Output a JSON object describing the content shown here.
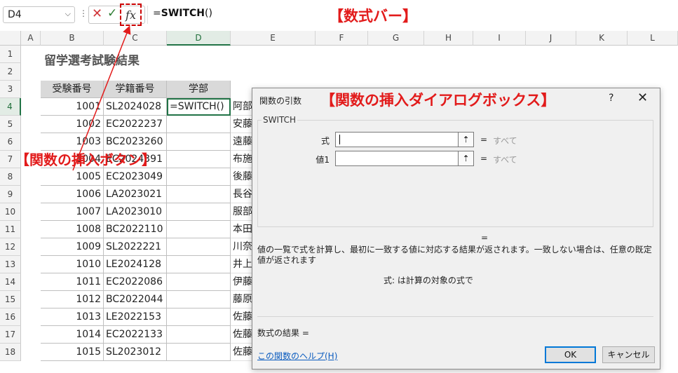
{
  "formula_bar": {
    "name_box": "D4",
    "formula_prefix": "=",
    "formula_func": "SWITCH",
    "formula_suffix": "()",
    "cancel_icon": "x-icon",
    "enter_icon": "check-icon",
    "fx_label": "fx"
  },
  "annotations": {
    "formula_bar": "【数式バー】",
    "insert_button": "【関数の挿入ボタン】",
    "dialog": "【関数の挿入ダイアログボックス】"
  },
  "columns": [
    "A",
    "B",
    "C",
    "D",
    "E",
    "F",
    "G",
    "H",
    "I",
    "J",
    "K",
    "L"
  ],
  "rows": [
    "1",
    "2",
    "3",
    "4",
    "5",
    "6",
    "7",
    "8",
    "9",
    "10",
    "11",
    "12",
    "13",
    "14",
    "15",
    "16",
    "17",
    "18"
  ],
  "sheet": {
    "title": "留学選考試験結果",
    "headers": [
      "受験番号",
      "学籍番号",
      "学部"
    ],
    "active_cell_value": "=SWITCH()",
    "records": [
      {
        "id": "1001",
        "student": "SL2024028",
        "name": "阿部"
      },
      {
        "id": "1002",
        "student": "EC2022237",
        "name": "安藤"
      },
      {
        "id": "1003",
        "student": "BC2023260",
        "name": "遠藤"
      },
      {
        "id": "1004",
        "student": "EC2024391",
        "name": "布施"
      },
      {
        "id": "1005",
        "student": "EC2023049",
        "name": "後藤"
      },
      {
        "id": "1006",
        "student": "LA2023021",
        "name": "長谷"
      },
      {
        "id": "1007",
        "student": "LA2023010",
        "name": "服部"
      },
      {
        "id": "1008",
        "student": "BC2022110",
        "name": "本田"
      },
      {
        "id": "1009",
        "student": "SL2022221",
        "name": "川奈"
      },
      {
        "id": "1010",
        "student": "LE2024128",
        "name": "井上"
      },
      {
        "id": "1011",
        "student": "EC2022086",
        "name": "伊藤"
      },
      {
        "id": "1012",
        "student": "BC2022044",
        "name": "藤原"
      },
      {
        "id": "1013",
        "student": "LE2022153",
        "name": "佐藤"
      },
      {
        "id": "1014",
        "student": "EC2022133",
        "name": "佐藤"
      },
      {
        "id": "1015",
        "student": "SL2023012",
        "name": "佐藤"
      }
    ]
  },
  "dialog": {
    "title": "関数の引数",
    "help": "?",
    "close": "✕",
    "function_name": "SWITCH",
    "args": [
      {
        "label": "式",
        "eq": "=",
        "value": "すべて"
      },
      {
        "label": "値1",
        "eq": "=",
        "value": "すべて"
      }
    ],
    "ref_icon": "⇡",
    "result_eq": "=",
    "description": "値の一覧で式を計算し、最初に一致する値に対応する結果が返されます。一致しない場合は、任意の既定値が返されます",
    "arg_description": "式:   は計算の対象の式で",
    "formula_result": "数式の結果 =",
    "help_link": "この関数のヘルプ(H)",
    "ok": "OK",
    "cancel": "キャンセル"
  }
}
